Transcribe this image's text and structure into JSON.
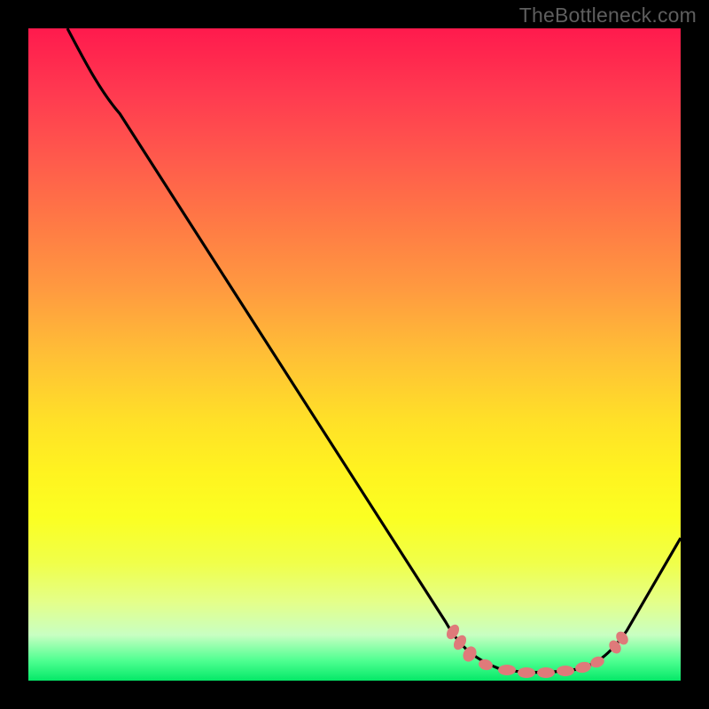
{
  "watermark": "TheBottleneck.com",
  "chart_data": {
    "type": "line",
    "title": "",
    "xlabel": "",
    "ylabel": "",
    "xlim": [
      0,
      100
    ],
    "ylim": [
      0,
      100
    ],
    "curve": [
      {
        "x": 6,
        "y": 100
      },
      {
        "x": 10,
        "y": 94
      },
      {
        "x": 14,
        "y": 87
      },
      {
        "x": 64,
        "y": 9
      },
      {
        "x": 67,
        "y": 5
      },
      {
        "x": 70,
        "y": 2.5
      },
      {
        "x": 75,
        "y": 1.3
      },
      {
        "x": 80,
        "y": 1.3
      },
      {
        "x": 85,
        "y": 1.7
      },
      {
        "x": 88,
        "y": 3
      },
      {
        "x": 92,
        "y": 8
      },
      {
        "x": 100,
        "y": 22
      }
    ],
    "markers": [
      {
        "x": 65,
        "y": 7.5
      },
      {
        "x": 66,
        "y": 6
      },
      {
        "x": 67.5,
        "y": 4.5
      },
      {
        "x": 70,
        "y": 2.5
      },
      {
        "x": 73,
        "y": 1.7
      },
      {
        "x": 76,
        "y": 1.3
      },
      {
        "x": 79,
        "y": 1.3
      },
      {
        "x": 82,
        "y": 1.4
      },
      {
        "x": 85,
        "y": 1.8
      },
      {
        "x": 87,
        "y": 2.5
      },
      {
        "x": 90,
        "y": 4.5
      },
      {
        "x": 91,
        "y": 6
      }
    ],
    "gradient_top_color": "#ff1a4d",
    "gradient_bottom_color": "#05e868",
    "curve_color": "#000000",
    "marker_color": "#e07878"
  }
}
